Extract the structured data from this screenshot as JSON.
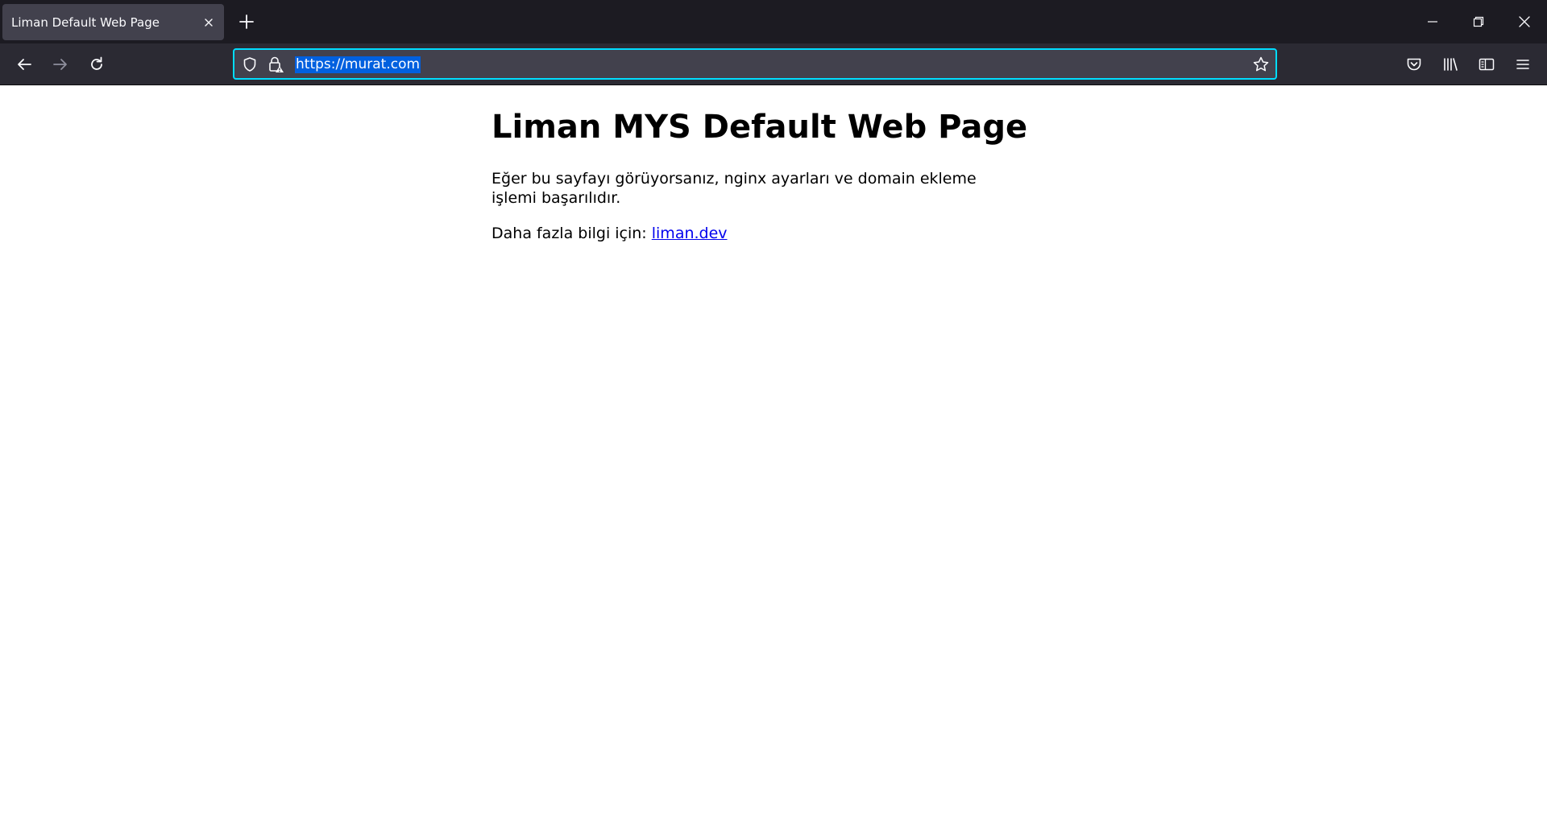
{
  "tab": {
    "title": "Liman Default Web Page"
  },
  "urlbar": {
    "url": "https://murat.com"
  },
  "page": {
    "heading": "Liman MYS Default Web Page",
    "paragraph1": "Eğer bu sayfayı görüyorsanız, nginx ayarları ve domain ekleme işlemi başarılıdır.",
    "paragraph2_prefix": "Daha fazla bilgi için: ",
    "link_text": "liman.dev"
  },
  "icons": {
    "tab_close": "close-icon",
    "new_tab": "plus-icon",
    "minimize": "minimize-icon",
    "restore": "restore-icon",
    "close_window": "close-icon",
    "back": "arrow-left-icon",
    "forward": "arrow-right-icon",
    "reload": "reload-icon",
    "tracking_protection": "shield-icon",
    "connection": "lock-warning-icon",
    "bookmark": "star-icon",
    "pocket": "pocket-icon",
    "library": "library-icon",
    "sidebar": "sidebar-icon",
    "menu": "hamburger-menu-icon"
  },
  "colors": {
    "tabstrip_bg": "#1c1b22",
    "toolbar_bg": "#2b2a33",
    "tab_bg": "#42414d",
    "urlbar_focus": "#00ddff",
    "selection": "#0060df",
    "link": "#0000ee"
  }
}
